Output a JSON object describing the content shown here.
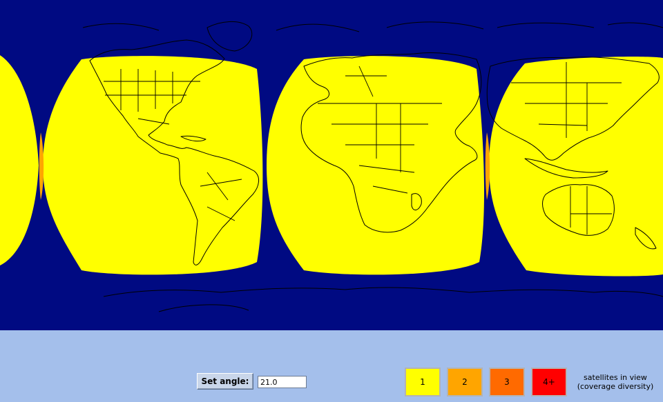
{
  "controls": {
    "set_angle_label": "Set angle:",
    "angle_value": "21.0"
  },
  "legend": {
    "items": [
      {
        "label": "1",
        "color": "#ffff00"
      },
      {
        "label": "2",
        "color": "#ffa500"
      },
      {
        "label": "3",
        "color": "#ff6a00"
      },
      {
        "label": "4+",
        "color": "#ff0000"
      }
    ],
    "caption_line1": "satellites in view",
    "caption_line2": "(coverage diversity)"
  },
  "colors": {
    "ocean": "#000a82",
    "coverage_1": "#ffff00",
    "coverage_2": "#ffa500",
    "panel": "#a4bfeb"
  }
}
